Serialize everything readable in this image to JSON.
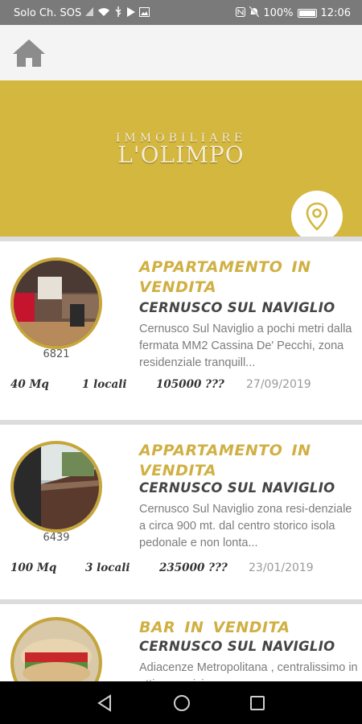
{
  "status_bar": {
    "left_text": "Solo Ch. SOS",
    "battery": "100%",
    "time": "12:06"
  },
  "app_bar": {
    "home_icon": "home-icon"
  },
  "header": {
    "logo_top": "IMMOBILIARE",
    "logo_main": "L'OLIMPO",
    "map_icon": "map-pin-icon"
  },
  "colors": {
    "accent": "#d3b73f",
    "title_gold": "#d0b043"
  },
  "listings": [
    {
      "ref": "6821",
      "title": "APPARTAMENTO  IN VENDITA",
      "city": "CERNUSCO SUL NAVIGLIO",
      "description": "Cernusco Sul Naviglio a pochi metri dalla fermata MM2 Cassina De' Pecchi, zona residenziale tranquill...",
      "area": "40 Mq",
      "rooms": "1 locali",
      "price": "105000 ???",
      "date": "27/09/2019"
    },
    {
      "ref": "6439",
      "title": "APPARTAMENTO  IN VENDITA",
      "city": "CERNUSCO SUL NAVIGLIO",
      "description": "Cernusco Sul Naviglio zona resi-denziale a circa 900 mt. dal centro storico isola pedonale e non lonta...",
      "area": "100 Mq",
      "rooms": "3 locali",
      "price": "235000 ???",
      "date": "23/01/2019"
    },
    {
      "title": "BAR  IN  VENDITA",
      "city": "CERNUSCO SUL NAVIGLIO",
      "description": "Adiacenze Metropolitana , centralissimo in ottima posizione"
    }
  ],
  "nav_bar": {
    "back_icon": "back-icon",
    "home_icon": "circle-home-icon",
    "recents_icon": "recents-icon"
  }
}
